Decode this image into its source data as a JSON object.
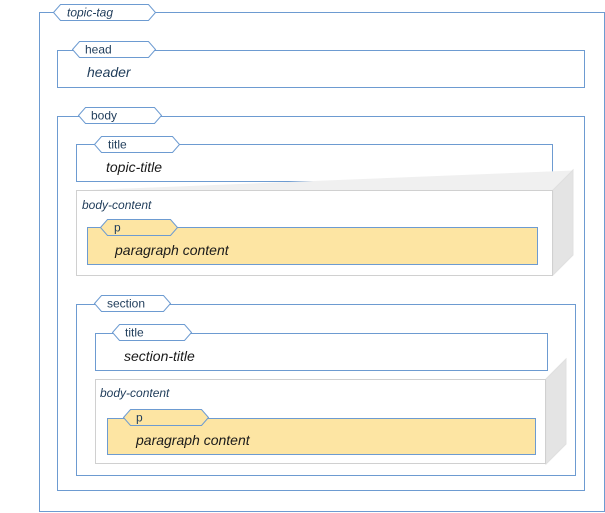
{
  "colors": {
    "border": "#6d9bd1",
    "tag_border": "#6d9bd1",
    "tag_fill": "#ffffff",
    "paragraph_fill": "#fde5a3",
    "paragraph_border": "#d9b75a",
    "body_content_border": "#d0d0d0",
    "body_content_side": "#e4e4e4",
    "text": "#1f3c5a"
  },
  "topic_tag": "topic-tag",
  "head": {
    "tag": "head",
    "content": "header"
  },
  "body": {
    "tag": "body",
    "title": {
      "tag": "title",
      "content": "topic-title"
    },
    "body_content": {
      "label": "body-content",
      "p": {
        "tag": "p",
        "content": "paragraph content"
      }
    }
  },
  "section": {
    "tag": "section",
    "title": {
      "tag": "title",
      "content": "section-title"
    },
    "body_content": {
      "label": "body-content",
      "p": {
        "tag": "p",
        "content": "paragraph content"
      }
    }
  }
}
